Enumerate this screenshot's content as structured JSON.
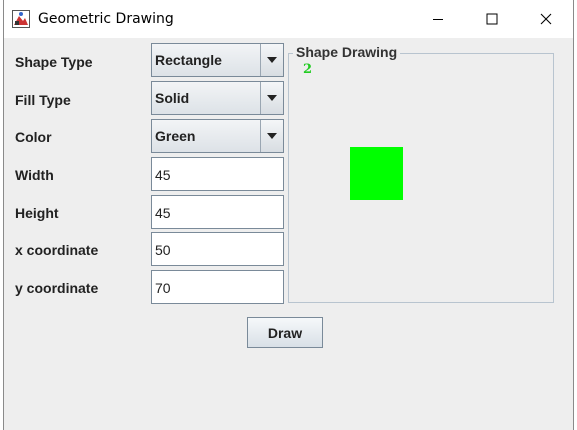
{
  "window": {
    "title": "Geometric Drawing",
    "icons": {
      "app": "app-icon",
      "minimize": "minimize-icon",
      "maximize": "maximize-icon",
      "close": "close-icon"
    }
  },
  "form": {
    "shape_type_label": "Shape Type",
    "shape_type_value": "Rectangle",
    "fill_type_label": "Fill Type",
    "fill_type_value": "Solid",
    "color_label": "Color",
    "color_value": "Green",
    "width_label": "Width",
    "width_value": "45",
    "height_label": "Height",
    "height_value": "45",
    "x_label": "x coordinate",
    "x_value": "50",
    "y_label": "y coordinate",
    "y_value": "70"
  },
  "panel": {
    "title": "Shape Drawing",
    "counter": "2",
    "counter_color": "#22cc22",
    "shape_color": "#00ff00"
  },
  "actions": {
    "draw_label": "Draw"
  }
}
